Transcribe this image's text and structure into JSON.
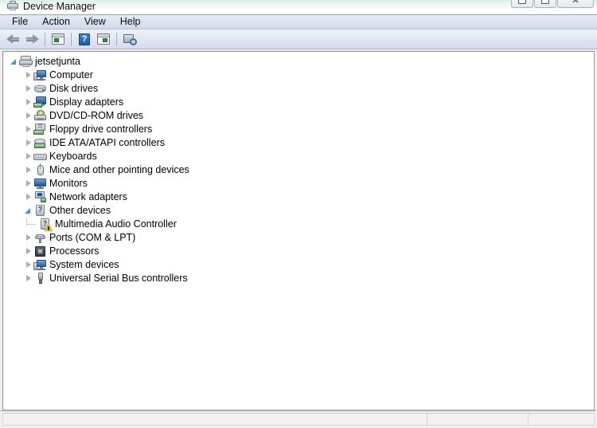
{
  "window": {
    "title": "Device Manager",
    "icon": "device-manager-icon",
    "buttons": {
      "minimize": "minimize",
      "maximize": "maximize",
      "close": "close"
    }
  },
  "menu": {
    "items": [
      {
        "label": "File",
        "name": "menu-file"
      },
      {
        "label": "Action",
        "name": "menu-action"
      },
      {
        "label": "View",
        "name": "menu-view"
      },
      {
        "label": "Help",
        "name": "menu-help"
      }
    ]
  },
  "toolbar": {
    "buttons": [
      {
        "name": "back-button",
        "icon": "back-arrow-icon",
        "label": "Back"
      },
      {
        "name": "forward-button",
        "icon": "forward-arrow-icon",
        "label": "Forward"
      },
      {
        "name": "show-hide-console-tree-button",
        "icon": "console-tree-icon",
        "label": "Show/Hide Console Tree"
      },
      {
        "name": "help-button",
        "icon": "help-question-icon",
        "label": "Help"
      },
      {
        "name": "properties-button",
        "icon": "properties-window-icon",
        "label": "Properties"
      },
      {
        "name": "scan-for-hardware-changes-button",
        "icon": "scan-hardware-icon",
        "label": "Scan for hardware changes"
      }
    ]
  },
  "tree": {
    "root": {
      "label": "jetsetjunta",
      "icon": "computer-root-icon",
      "expanded": true
    },
    "nodes": [
      {
        "label": "Computer",
        "icon": "computer-icon",
        "expanded": false,
        "depth": 1
      },
      {
        "label": "Disk drives",
        "icon": "disk-drive-icon",
        "expanded": false,
        "depth": 1
      },
      {
        "label": "Display adapters",
        "icon": "display-adapter-icon",
        "expanded": false,
        "depth": 1
      },
      {
        "label": "DVD/CD-ROM drives",
        "icon": "dvd-cdrom-icon",
        "expanded": false,
        "depth": 1
      },
      {
        "label": "Floppy drive controllers",
        "icon": "floppy-controller-icon",
        "expanded": false,
        "depth": 1
      },
      {
        "label": "IDE ATA/ATAPI controllers",
        "icon": "ide-controller-icon",
        "expanded": false,
        "depth": 1
      },
      {
        "label": "Keyboards",
        "icon": "keyboard-icon",
        "expanded": false,
        "depth": 1
      },
      {
        "label": "Mice and other pointing devices",
        "icon": "mouse-icon",
        "expanded": false,
        "depth": 1
      },
      {
        "label": "Monitors",
        "icon": "monitor-icon",
        "expanded": false,
        "depth": 1
      },
      {
        "label": "Network adapters",
        "icon": "network-adapter-icon",
        "expanded": false,
        "depth": 1
      },
      {
        "label": "Other devices",
        "icon": "other-devices-icon",
        "expanded": true,
        "depth": 1
      },
      {
        "label": "Multimedia Audio Controller",
        "icon": "unknown-device-warning-icon",
        "expanded": null,
        "depth": 2,
        "warning": true
      },
      {
        "label": "Ports (COM & LPT)",
        "icon": "ports-icon",
        "expanded": false,
        "depth": 1
      },
      {
        "label": "Processors",
        "icon": "processor-icon",
        "expanded": false,
        "depth": 1
      },
      {
        "label": "System devices",
        "icon": "system-devices-icon",
        "expanded": false,
        "depth": 1
      },
      {
        "label": "Universal Serial Bus controllers",
        "icon": "usb-controller-icon",
        "expanded": false,
        "depth": 1
      }
    ]
  },
  "statusbar": {
    "panels": [
      "",
      "",
      ""
    ]
  },
  "colors": {
    "expander_expanded": "#3d9bc9",
    "expander_collapsed": "#9aa0a6",
    "warning_yellow": "#f2c218",
    "tree_background": "#ffffff",
    "chrome_background": "#f0f0f0",
    "menubar_gradient_top": "#e6eaf4",
    "menubar_gradient_bottom": "#d3daec"
  }
}
